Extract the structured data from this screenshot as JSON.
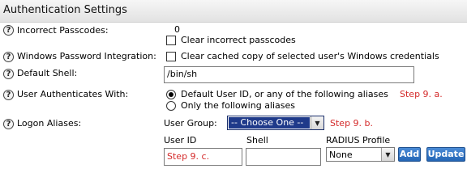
{
  "header": {
    "title": "Authentication Settings"
  },
  "rows": {
    "incorrect_passcodes": {
      "label": "Incorrect Passcodes:",
      "value": "0",
      "checkbox_label": "Clear incorrect passcodes"
    },
    "windows_password": {
      "label": "Windows Password Integration:",
      "checkbox_label": "Clear cached copy of selected user's Windows credentials"
    },
    "default_shell": {
      "label": "Default Shell:",
      "value": "/bin/sh"
    },
    "authenticates_with": {
      "label": "User Authenticates With:",
      "option_default": "Default User ID, or any of the following aliases",
      "option_only": "Only the following aliases",
      "step": "Step 9. a."
    },
    "logon_aliases": {
      "label": "Logon Aliases:",
      "user_group_label": "User Group:",
      "user_group_value": "-- Choose One --",
      "step_group": "Step 9. b.",
      "col_user_id": "User ID",
      "col_shell": "Shell",
      "col_radius": "RADIUS Profile",
      "user_id_value": "Step 9. c.",
      "radius_value": "None",
      "add_label": "Add",
      "update_label": "Update"
    }
  },
  "colors": {
    "step_annotation": "#d42a2a",
    "button": "#2466b6",
    "selected": "#1f3a8a"
  }
}
